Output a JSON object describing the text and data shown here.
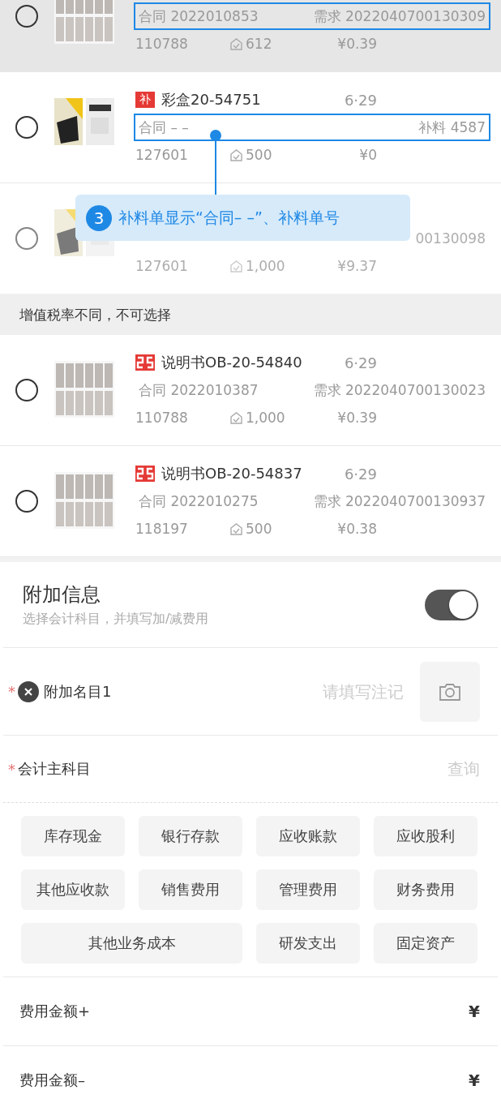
{
  "orders": [
    {
      "highlighted": true,
      "disabled": false,
      "selected": false,
      "contract": "合同 2022010853",
      "demand": "需求 2022040700130309",
      "outlined": true,
      "code": "110788",
      "stock": "612",
      "price": "¥0.39"
    },
    {
      "highlighted": false,
      "disabled": false,
      "selected": false,
      "badge": "补",
      "title": "彩盒20-54751",
      "date": "6·29",
      "contract": "合同 – –",
      "demand": "补料 4587",
      "outlined": true,
      "code": "127601",
      "stock": "500",
      "price": "¥0"
    },
    {
      "highlighted": false,
      "disabled": true,
      "selected": false,
      "demand": "00130098",
      "outlined": false,
      "code": "127601",
      "stock": "1,000",
      "price": "¥9.37"
    }
  ],
  "callout": {
    "number": "3",
    "text": "补料单显示“合同– –”、补料单号"
  },
  "section_header": "增值税率不同，不可选择",
  "other_orders": [
    {
      "highlighted": false,
      "disabled": false,
      "selected": false,
      "title": "说明书OB-20-54840",
      "date": "6·29",
      "contract": "合同 2022010387",
      "demand": "需求 2022040700130023",
      "outlined": false,
      "code": "110788",
      "stock": "1,000",
      "price": "¥0.39"
    },
    {
      "highlighted": false,
      "disabled": false,
      "selected": false,
      "title": "说明书OB-20-54837",
      "date": "6·29",
      "contract": "合同 2022010275",
      "demand": "需求 2022040700130937",
      "outlined": false,
      "code": "118197",
      "stock": "500",
      "price": "¥0.38"
    }
  ],
  "extra": {
    "title": "附加信息",
    "subtitle": "选择会计科目，并填写加/减费用",
    "on": true
  },
  "item_row": {
    "required_mark": "*",
    "label": "附加名目1",
    "placeholder": "请填写注记"
  },
  "subject_row": {
    "required_mark": "*",
    "label": "会计主科目",
    "action": "查询"
  },
  "subjects": [
    {
      "label": "库存现金",
      "wide": false
    },
    {
      "label": "银行存款",
      "wide": false
    },
    {
      "label": "应收账款",
      "wide": false
    },
    {
      "label": "应收股利",
      "wide": false
    },
    {
      "label": "其他应收款",
      "wide": false
    },
    {
      "label": "销售费用",
      "wide": false
    },
    {
      "label": "管理费用",
      "wide": false
    },
    {
      "label": "财务费用",
      "wide": false
    },
    {
      "label": "其他业务成本",
      "wide": true
    },
    {
      "label": "研发支出",
      "wide": false
    },
    {
      "label": "固定资产",
      "wide": false
    }
  ],
  "amounts": [
    {
      "label": "费用金额+",
      "currency": "¥"
    },
    {
      "label": "费用金额–",
      "currency": "¥"
    }
  ]
}
